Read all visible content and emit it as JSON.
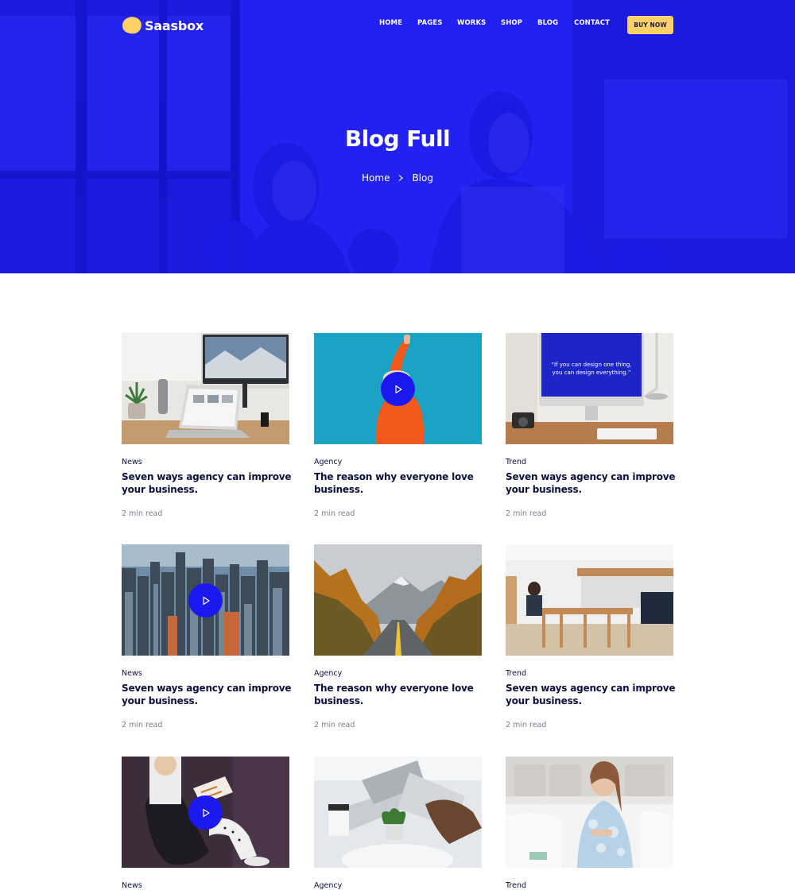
{
  "brand": {
    "name": "Saasbox",
    "logo_color": "#ffd166"
  },
  "nav": {
    "items": [
      "HOME",
      "PAGES",
      "WORKS",
      "SHOP",
      "BLOG",
      "CONTACT"
    ],
    "cta": "BUY NOW"
  },
  "hero": {
    "title": "Blog Full",
    "breadcrumb": [
      "Home",
      "Blog"
    ],
    "overlay_color": "#1f1ff2"
  },
  "posts": [
    {
      "category": "News",
      "title": "Seven ways agency can improve your business.",
      "read": "2 min read",
      "video": false,
      "image": "laptop-desk"
    },
    {
      "category": "Agency",
      "title": "The reason why everyone love business.",
      "read": "2 min read",
      "video": true,
      "image": "woman-orange-sweater"
    },
    {
      "category": "Trend",
      "title": "Seven ways agency can improve your business.",
      "read": "2 min read",
      "video": false,
      "image": "imac-quote",
      "image_text": [
        "“If you can design one thing,",
        "you can design everything.”"
      ]
    },
    {
      "category": "News",
      "title": "Seven ways agency can improve your business.",
      "read": "2 min read",
      "video": true,
      "image": "city-skyline"
    },
    {
      "category": "Agency",
      "title": "The reason why everyone love business.",
      "read": "2 min read",
      "video": false,
      "image": "mountain-road"
    },
    {
      "category": "Trend",
      "title": "Seven ways agency can improve your business.",
      "read": "2 min read",
      "video": false,
      "image": "cafe-interior"
    },
    {
      "category": "News",
      "title": "",
      "read": "",
      "video": true,
      "image": "reading-chair"
    },
    {
      "category": "Agency",
      "title": "",
      "read": "",
      "video": false,
      "image": "laptops-coffee"
    },
    {
      "category": "Trend",
      "title": "",
      "read": "",
      "video": false,
      "image": "woman-bed"
    }
  ],
  "colors": {
    "primary": "#1b19f0",
    "heading": "#0b0f3d",
    "muted": "#7a7f8e",
    "cta": "#ffd166"
  }
}
